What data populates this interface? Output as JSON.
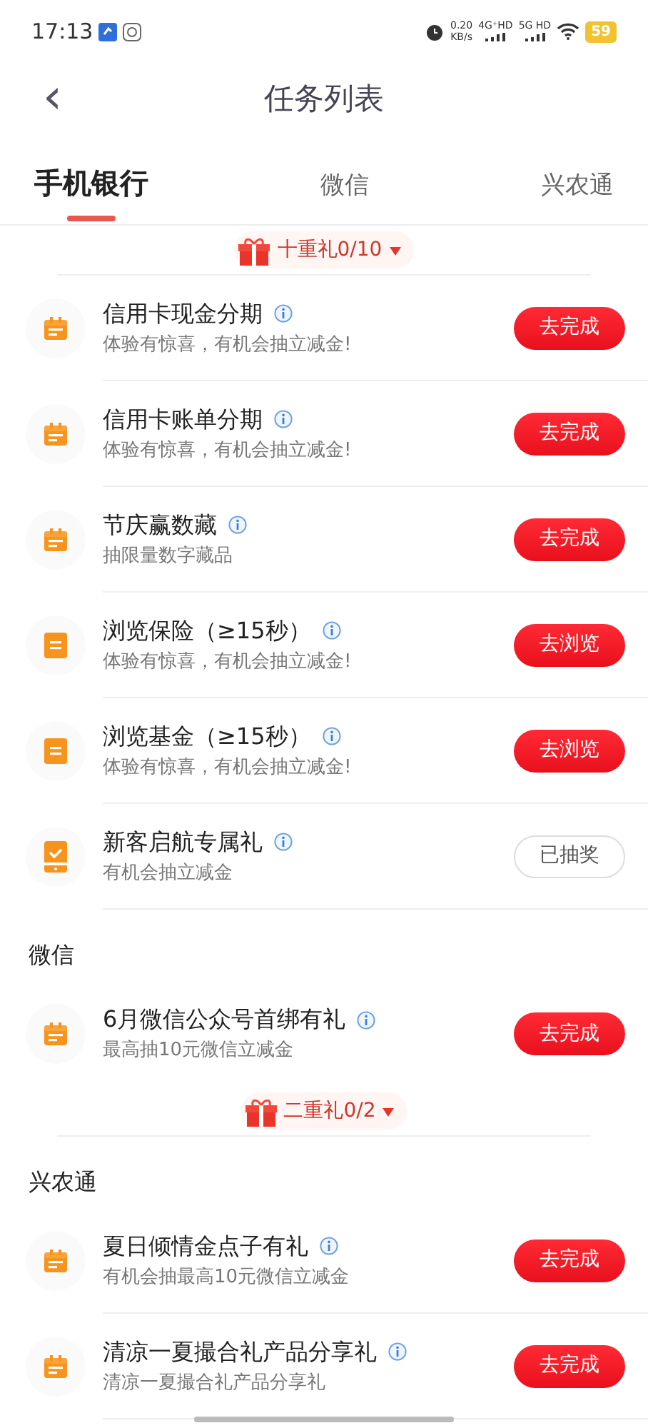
{
  "status_bar": {
    "time": "17:13",
    "speed": "0.20",
    "speed_unit": "KB/s",
    "net1": "4G⁺HD",
    "net2": "5G HD",
    "battery": "59"
  },
  "header": {
    "back": "‹",
    "title": "任务列表"
  },
  "tabs": [
    {
      "label": "手机银行",
      "selected": true
    },
    {
      "label": "微信",
      "selected": false
    },
    {
      "label": "兴农通",
      "selected": false
    }
  ],
  "sections": [
    {
      "gift_top": "十重礼0/10",
      "tasks": [
        {
          "kind": "calendar",
          "title": "信用卡现金分期",
          "subtitle": "体验有惊喜，有机会抽立减金!",
          "button": "去完成",
          "done": false
        },
        {
          "kind": "calendar",
          "title": "信用卡账单分期",
          "subtitle": "体验有惊喜，有机会抽立减金!",
          "button": "去完成",
          "done": false
        },
        {
          "kind": "calendar",
          "title": "节庆赢数藏",
          "subtitle": "抽限量数字藏品",
          "button": "去完成",
          "done": false
        },
        {
          "kind": "document",
          "title": "浏览保险（≥15秒）",
          "subtitle": "体验有惊喜，有机会抽立减金!",
          "button": "去浏览",
          "done": false
        },
        {
          "kind": "document",
          "title": "浏览基金（≥15秒）",
          "subtitle": "体验有惊喜，有机会抽立减金!",
          "button": "去浏览",
          "done": false
        },
        {
          "kind": "phone",
          "title": "新客启航专属礼",
          "subtitle": "有机会抽立减金",
          "button": "已抽奖",
          "done": true
        }
      ]
    },
    {
      "heading": "微信",
      "tasks": [
        {
          "kind": "calendar",
          "title": "6月微信公众号首绑有礼",
          "subtitle": "最高抽10元微信立减金",
          "button": "去完成",
          "done": false
        }
      ],
      "gift_bottom": "二重礼0/2"
    },
    {
      "heading": "兴农通",
      "tasks": [
        {
          "kind": "calendar",
          "title": "夏日倾情金点子有礼",
          "subtitle": "有机会抽最高10元微信立减金",
          "button": "去完成",
          "done": false
        },
        {
          "kind": "calendar",
          "title": "清凉一夏撮合礼产品分享礼",
          "subtitle": "清凉一夏撮合礼产品分享礼",
          "button": "去完成",
          "done": false
        }
      ]
    }
  ]
}
